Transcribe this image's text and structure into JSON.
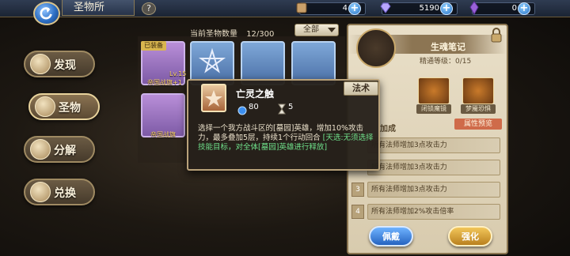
{
  "header": {
    "title": "圣物所",
    "help_label": "?"
  },
  "resources": [
    {
      "icon": "scroll-icon",
      "value": "4",
      "plus": "+"
    },
    {
      "icon": "diamond-icon",
      "value": "5190",
      "plus": "+"
    },
    {
      "icon": "crystal-icon",
      "value": "0",
      "plus": "+"
    }
  ],
  "nav": {
    "items": [
      {
        "label": "发现",
        "icon": "discover-icon"
      },
      {
        "label": "圣物",
        "icon": "relic-icon"
      },
      {
        "label": "分解",
        "icon": "decompose-icon"
      },
      {
        "label": "兑换",
        "icon": "exchange-icon"
      }
    ]
  },
  "relic_list": {
    "count_label": "当前圣物数量",
    "count_value": "12/300",
    "filter_label": "全部",
    "equipped_tag": "已装备",
    "slot_labels": [
      "帝国战旗+1",
      "Lv.15",
      "帝国战旗"
    ]
  },
  "detail": {
    "title": "生魂笔记",
    "level_label": "精通等级：0/15",
    "chips": [
      "闭锁魔镜",
      "梦魇恐惧"
    ],
    "bonus_title": "加成",
    "bonus_button": "属性预览",
    "bonus_rows": [
      {
        "num": "",
        "text": "所有法师增加3点攻击力"
      },
      {
        "num": "",
        "text": "所有法师增加3点攻击力"
      },
      {
        "num": "3",
        "text": "所有法师增加3点攻击力"
      },
      {
        "num": "4",
        "text": "所有法师增加2%攻击倍率"
      }
    ],
    "equip_button": "佩戴",
    "upgrade_button": "强化"
  },
  "tooltip": {
    "name": "亡灵之触",
    "tag": "法术",
    "cost_value": "80",
    "time_value": "5",
    "desc_plain": "选择一个我方战斗区的[墓园]英雄，增加10%攻击力，最多叠加5层，持续1个行动回合 ",
    "desc_highlight": "[天选:无须选择技能目标，对全体[墓园]英雄进行释放]"
  },
  "colors": {
    "accent_gold": "#c9a86a",
    "highlight_green": "#6fe08a",
    "bonus_button": "#cf6b4a"
  }
}
